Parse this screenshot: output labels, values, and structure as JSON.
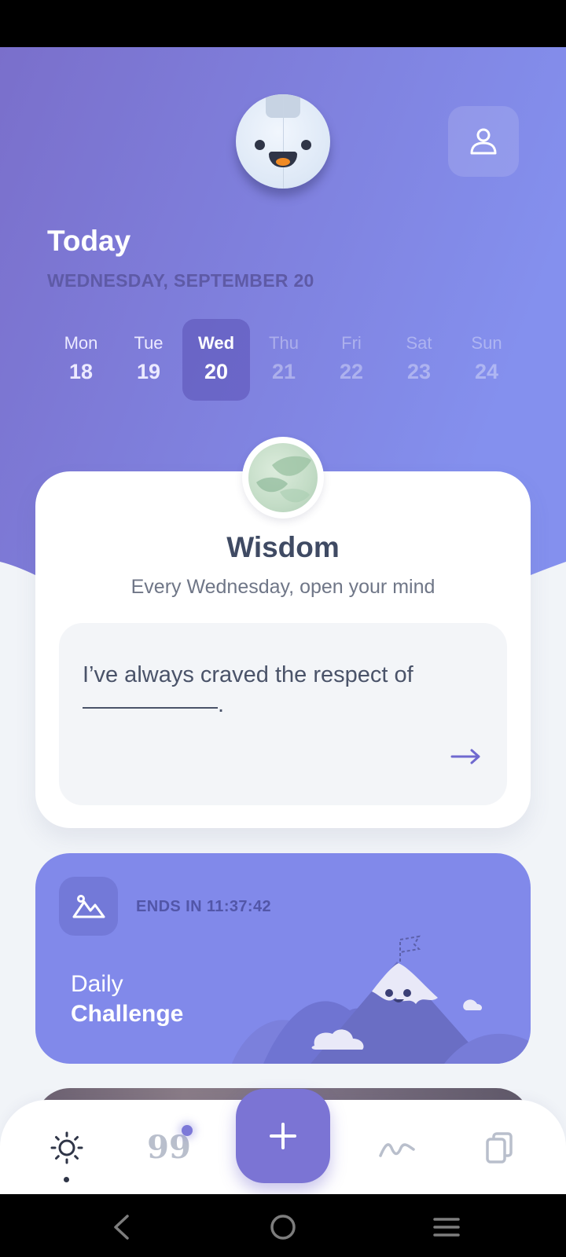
{
  "colors": {
    "header_gradient_start": "#7a6fcb",
    "header_gradient_end": "#8490ee",
    "accent": "#7b74d4",
    "challenge_card": "#8189ea",
    "background": "#f1f4f8",
    "text_dark": "#3f4a63"
  },
  "header": {
    "title": "Today",
    "date": "WEDNESDAY, SEPTEMBER 20",
    "mascot_icon": "mascot-face",
    "profile_icon": "user-icon"
  },
  "week": [
    {
      "day": "Mon",
      "num": "18",
      "state": "past"
    },
    {
      "day": "Tue",
      "num": "19",
      "state": "past"
    },
    {
      "day": "Wed",
      "num": "20",
      "state": "active"
    },
    {
      "day": "Thu",
      "num": "21",
      "state": "future"
    },
    {
      "day": "Fri",
      "num": "22",
      "state": "future"
    },
    {
      "day": "Sat",
      "num": "23",
      "state": "future"
    },
    {
      "day": "Sun",
      "num": "24",
      "state": "future"
    }
  ],
  "wisdom": {
    "title": "Wisdom",
    "subtitle": "Every Wednesday, open your mind",
    "prompt": "I’ve always craved the respect of",
    "blank_end": ".",
    "arrow_icon": "arrow-right-icon",
    "badge_icon": "leaves-icon"
  },
  "challenge": {
    "ends_in": "ENDS IN 11:37:42",
    "line1": "Daily",
    "line2": "Challenge",
    "icon": "mountain-icon"
  },
  "bottom_nav": {
    "items": [
      {
        "icon": "sun-icon",
        "selected": true
      },
      {
        "icon": "quotes-icon",
        "glyph": "99",
        "badge": true
      },
      {
        "icon": "plus-icon"
      },
      {
        "icon": "wave-icon"
      },
      {
        "icon": "copy-icon"
      }
    ]
  },
  "system_nav": [
    "back-icon",
    "home-icon",
    "recents-icon"
  ]
}
